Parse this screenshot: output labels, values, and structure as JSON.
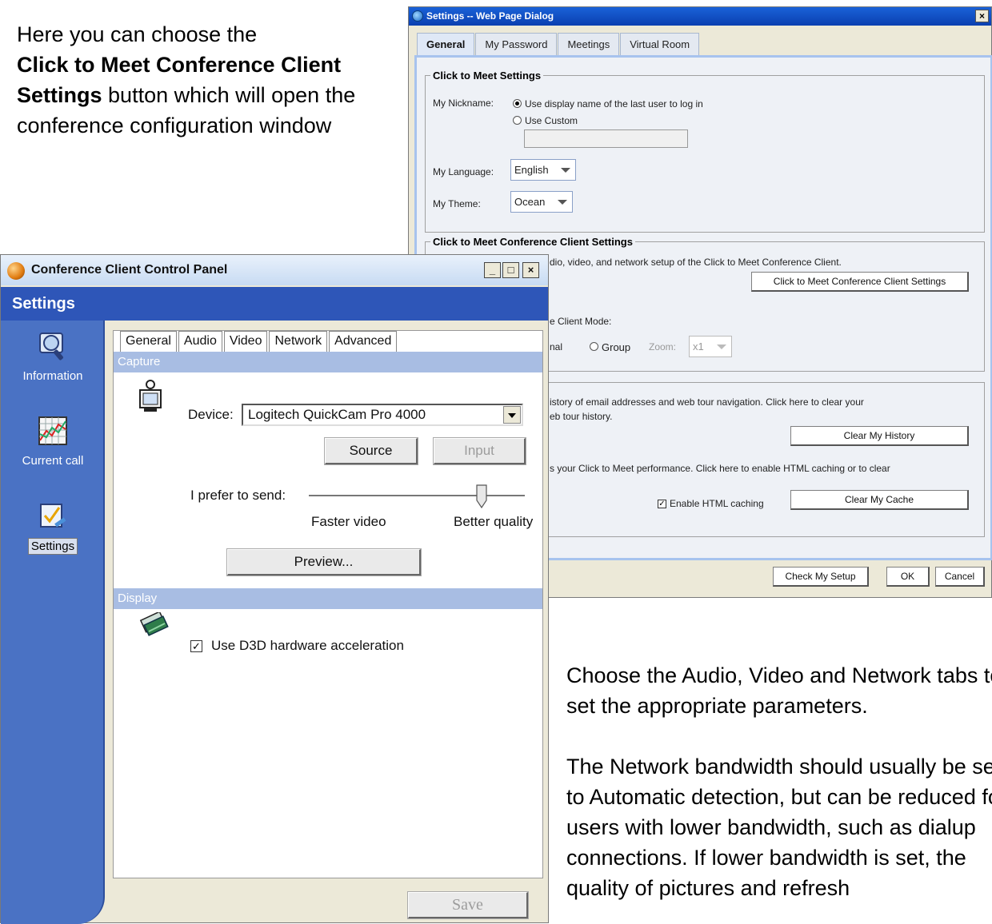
{
  "slide": {
    "intro_prefix": "Here you can choose the",
    "intro_bold": "Click to Meet Conference Client Settings",
    "intro_suffix": "button which will open the conference configuration window",
    "notes_1": "Choose the Audio, Video and Network tabs to set the appropriate parameters.",
    "notes_2": "The Network bandwidth should usually be set to Automatic detection, but can be reduced for users with lower bandwidth, such as dialup connections. If lower bandwidth is set, the quality of pictures and refresh"
  },
  "web_dialog": {
    "title": "Settings -- Web Page Dialog",
    "close_glyph": "×",
    "tabs": [
      "General",
      "My Password",
      "Meetings",
      "Virtual Room"
    ],
    "active_tab": "General",
    "click_to_meet": {
      "legend": "Click to Meet Settings",
      "nickname_label": "My Nickname:",
      "nickname_option_1": "Use display name of the last user to log in",
      "nickname_option_2": "Use Custom",
      "nickname_selected": "Use display name of the last user to log in",
      "language_label": "My Language:",
      "language_value": "English",
      "theme_label": "My Theme:",
      "theme_value": "Ocean"
    },
    "conference_client": {
      "legend": "Click to Meet Conference Client Settings",
      "description_partial": "Click to ... dio, video, and network setup of the Click to Meet Conference Client.",
      "description_visible": "dio, video, and network setup of the Click to Meet Conference Client.",
      "settings_button": "Click to Meet Conference Client Settings",
      "mode_label": "e Client Mode:",
      "mode_option_1": "nal",
      "mode_option_2": "Group",
      "zoom_label": "Zoom:",
      "zoom_value": "x1"
    },
    "history": {
      "text_line_1": "istory of email addresses and web tour navigation. Click here to clear your",
      "text_line_2": "eb tour history.",
      "clear_history_button": "Clear My History",
      "cache_text": "s your Click to Meet performance. Click here to enable HTML caching or to clear",
      "enable_caching_label": "Enable HTML caching",
      "enable_caching_checked": true,
      "clear_cache_button": "Clear My Cache"
    },
    "footer": {
      "check_setup_button": "Check My Setup",
      "ok_button": "OK",
      "cancel_button": "Cancel"
    }
  },
  "control_panel": {
    "title": "Conference Client Control Panel",
    "header": "Settings",
    "minimize_glyph": "_",
    "maximize_glyph": "□",
    "close_glyph": "×",
    "sidebar": [
      {
        "label": "Information",
        "icon": "information-icon"
      },
      {
        "label": "Current call",
        "icon": "current-call-icon"
      },
      {
        "label": "Settings",
        "icon": "settings-icon"
      }
    ],
    "active_sidebar": "Settings",
    "tabs": [
      "General",
      "Audio",
      "Video",
      "Network",
      "Advanced"
    ],
    "active_tab": "Video",
    "capture": {
      "section_label": "Capture",
      "device_label": "Device:",
      "device_value": "Logitech QuickCam Pro 4000",
      "source_button": "Source",
      "input_button": "Input",
      "prefer_label": "I prefer to send:",
      "slider_min_label": "Faster video",
      "slider_max_label": "Better quality",
      "slider_value": 0.8,
      "preview_button": "Preview..."
    },
    "display": {
      "section_label": "Display",
      "d3d_label": "Use D3D hardware acceleration",
      "d3d_checked": true
    },
    "save_button": "Save"
  },
  "colors": {
    "ccp_header": "#2e56b8",
    "ccp_sidebar": "#4a72c4",
    "section_bar": "#a8bde3",
    "web_title": "#0a3fb0",
    "web_panel_border": "#a7c3ee"
  }
}
